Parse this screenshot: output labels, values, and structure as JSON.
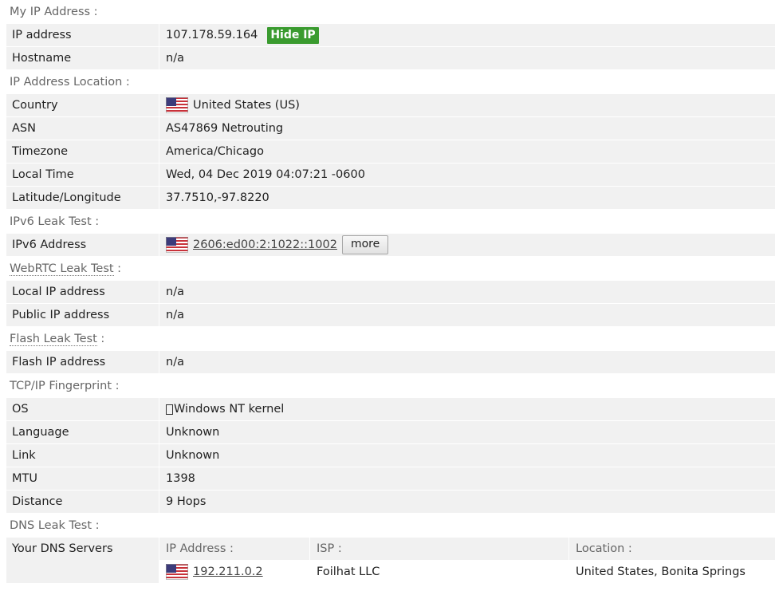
{
  "colors": {
    "row_bg": "#f1f1f1",
    "heading": "#666666",
    "hide_ip_bg": "#3a9b2f"
  },
  "my_ip": {
    "title": "My IP Address :",
    "ip_label": "IP address",
    "ip_value": "107.178.59.164",
    "hide_ip": "Hide IP",
    "hostname_label": "Hostname",
    "hostname_value": "n/a"
  },
  "location": {
    "title": "IP Address Location :",
    "rows": [
      {
        "label": "Country",
        "value": "United States (US)",
        "icon": "us-flag-icon"
      },
      {
        "label": "ASN",
        "value": "AS47869 Netrouting"
      },
      {
        "label": "Timezone",
        "value": "America/Chicago"
      },
      {
        "label": "Local Time",
        "value": "Wed, 04 Dec 2019 04:07:21 -0600"
      },
      {
        "label": "Latitude/Longitude",
        "value": "37.7510,-97.8220"
      }
    ]
  },
  "ipv6": {
    "title": "IPv6 Leak Test :",
    "label": "IPv6 Address",
    "value": "2606:ed00:2:1022::1002",
    "more": "more"
  },
  "webrtc": {
    "title_link": "WebRTC Leak Test",
    "title_sep": " :",
    "rows": [
      {
        "label": "Local IP address",
        "value": "n/a"
      },
      {
        "label": "Public IP address",
        "value": "n/a"
      }
    ]
  },
  "flash": {
    "title_link": "Flash Leak Test",
    "title_sep": " :",
    "label": "Flash IP address",
    "value": "n/a"
  },
  "tcpip": {
    "title": "TCP/IP Fingerprint :",
    "os_label": "OS",
    "os_value": "Windows NT kernel",
    "rows": [
      {
        "label": "Language",
        "value": "Unknown"
      },
      {
        "label": "Link",
        "value": "Unknown"
      },
      {
        "label": "MTU",
        "value": "1398"
      },
      {
        "label": "Distance",
        "value": "9 Hops"
      }
    ]
  },
  "dns": {
    "title": "DNS Leak Test :",
    "label": "Your DNS Servers",
    "headers": [
      "IP Address :",
      "ISP :",
      "Location :"
    ],
    "servers": [
      {
        "ip": "192.211.0.2",
        "isp": "Foilhat LLC",
        "location": "United States, Bonita Springs"
      }
    ]
  }
}
